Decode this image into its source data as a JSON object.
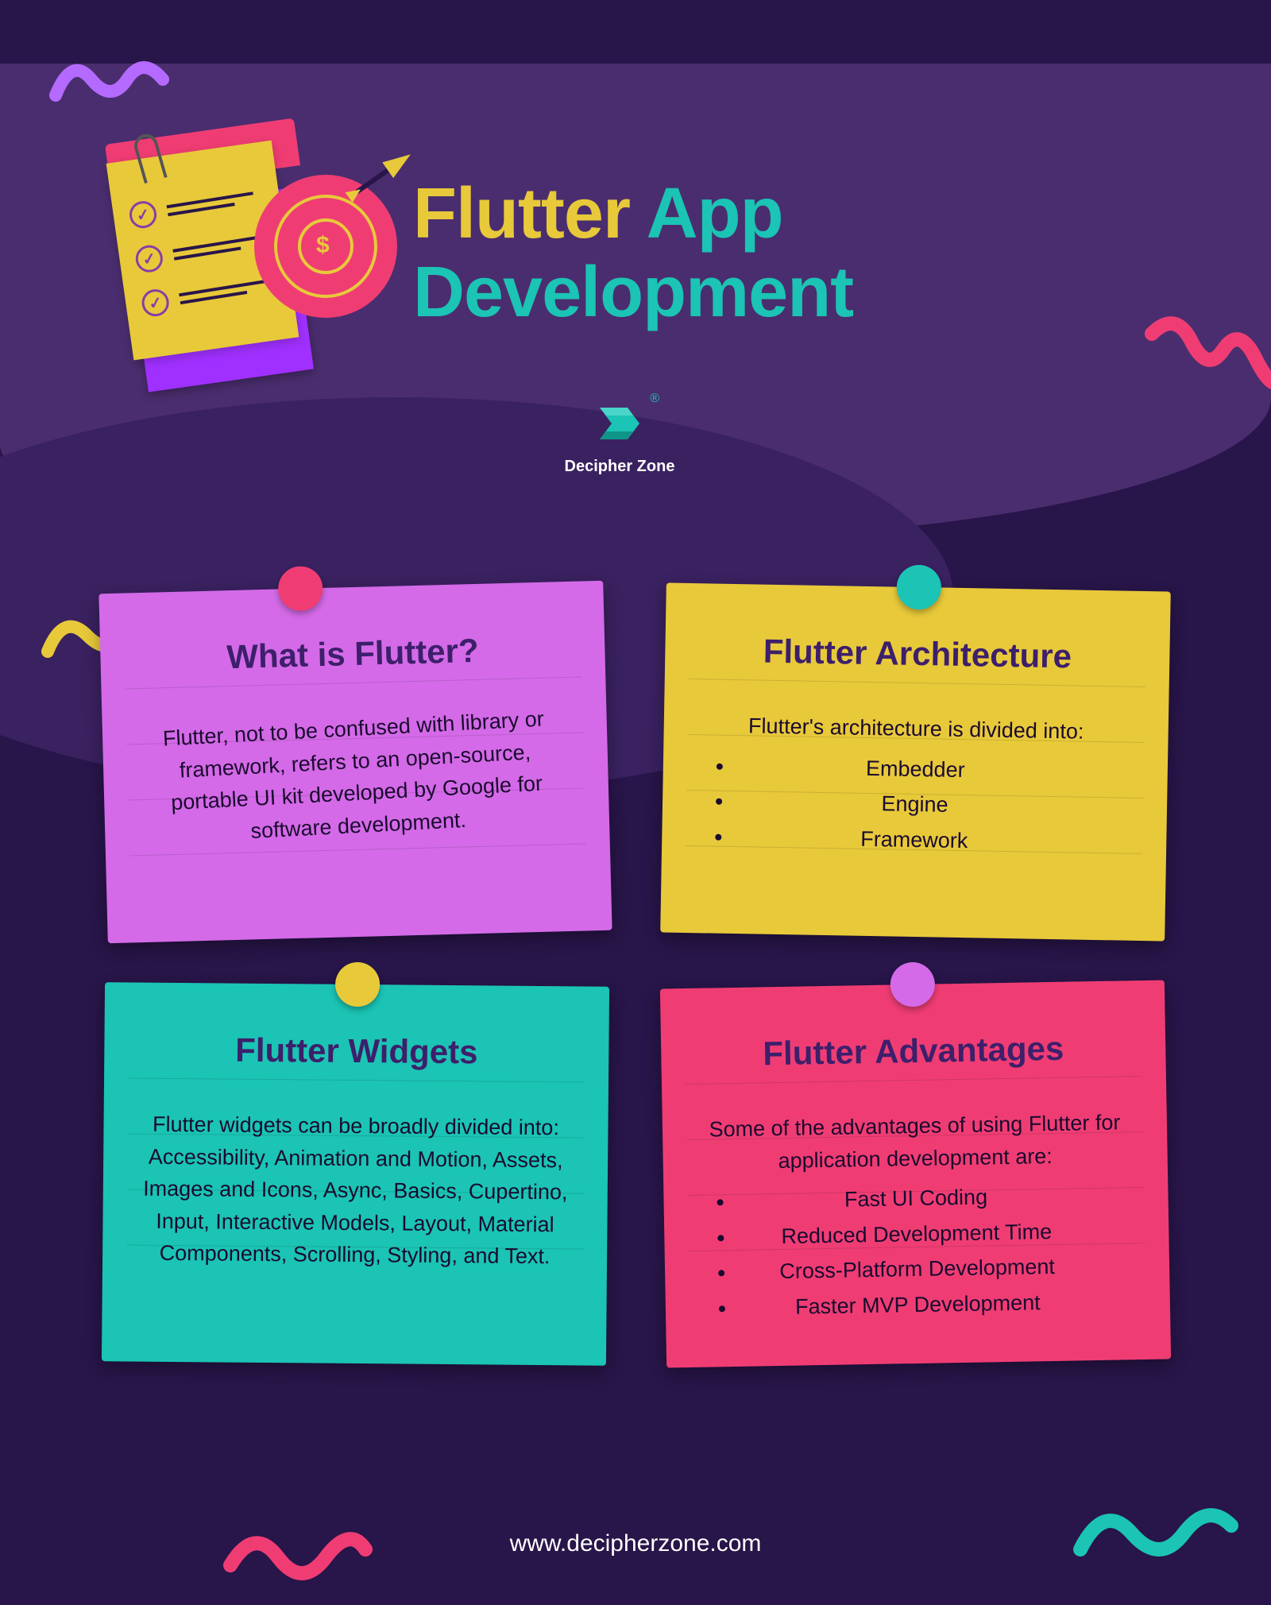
{
  "title": {
    "w1": "Flutter",
    "w2": "App",
    "w3": "Development"
  },
  "brand": {
    "name": "Decipher Zone",
    "registered": "®"
  },
  "cards": {
    "what": {
      "heading": "What is Flutter?",
      "body": "Flutter, not to be confused with library or framework, refers to an open-source, portable UI kit developed by Google for software development."
    },
    "arch": {
      "heading": "Flutter Architecture",
      "intro": "Flutter's architecture is divided into:",
      "items": [
        "Embedder",
        "Engine",
        "Framework"
      ]
    },
    "widgets": {
      "heading": "Flutter Widgets",
      "body": "Flutter widgets can be broadly divided into: Accessibility, Animation and Motion, Assets, Images and Icons, Async, Basics, Cupertino, Input, Interactive Models, Layout, Material Components, Scrolling, Styling, and Text."
    },
    "adv": {
      "heading": "Flutter Advantages",
      "intro": "Some of the advantages of using Flutter for application development are:",
      "items": [
        "Fast UI Coding",
        "Reduced Development Time",
        "Cross-Platform Development",
        "Faster MVP Development"
      ]
    }
  },
  "footer": {
    "url": "www.decipherzone.com"
  },
  "colors": {
    "bg": "#281549",
    "yellow": "#e8c93a",
    "teal": "#1bc4b4",
    "pink": "#ef3d74",
    "magenta": "#d46ae8",
    "purple": "#a030ff"
  }
}
